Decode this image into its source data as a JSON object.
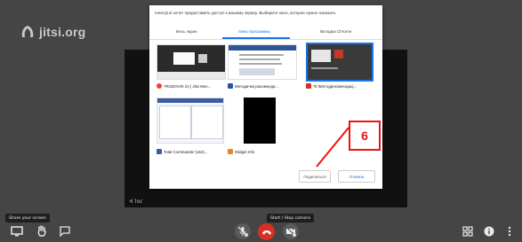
{
  "logo": {
    "text": "jitsi.org",
    "icon": "jitsi-logo-icon"
  },
  "dialog": {
    "prompt": "meet.jit.si хочет предоставить доступ к вашему экрану. Выберите окно, которое нужно показать.",
    "tabs": [
      {
        "label": "Весь экран",
        "active": false
      },
      {
        "label": "Окно программы",
        "active": true
      },
      {
        "label": "Вкладка Chrome",
        "active": false
      }
    ],
    "windows": [
      {
        "label": "TRUDOVIK 24 | Jitsi Mee...",
        "icon": "chrome-icon",
        "icon_color": "#e94235",
        "selected": false
      },
      {
        "label": "Методичка рекоменда...",
        "icon": "word-icon",
        "icon_color": "#2b579a",
        "selected": false
      },
      {
        "label": "\"E:\\Методрекомендаці...",
        "icon": "app-icon",
        "icon_color": "#d93025",
        "selected": true
      },
      {
        "label": "Total Commander (x64)...",
        "icon": "total-commander-icon",
        "icon_color": "#3b5ba5",
        "selected": false
      },
      {
        "label": "Widget Info",
        "icon": "widget-icon",
        "icon_color": "#e08a2a",
        "selected": false
      }
    ],
    "share_label": "Поделиться",
    "cancel_label": "Отмена"
  },
  "annotation": {
    "number": "6",
    "color": "#ee1111"
  },
  "stage_label": "∢ loc",
  "tooltips": {
    "share_screen": "Share your screen",
    "camera": "Start / Stop camera"
  },
  "toolbar": {
    "left": [
      "screen-share-icon",
      "raise-hand-icon",
      "chat-icon"
    ],
    "center": [
      "microphone-muted-icon",
      "hangup-icon",
      "camera-muted-icon"
    ],
    "right": [
      "tile-view-icon",
      "info-icon",
      "more-icon"
    ],
    "hangup_color": "#d93025"
  }
}
